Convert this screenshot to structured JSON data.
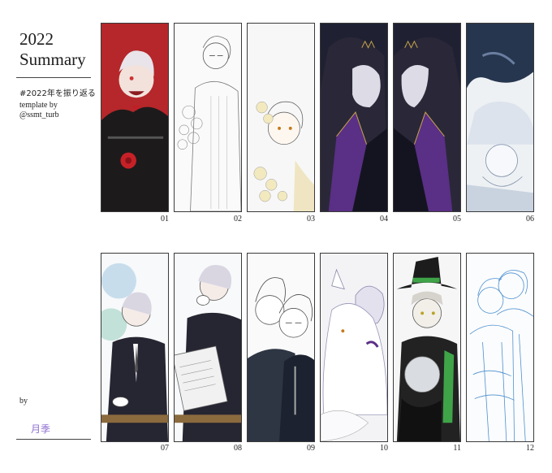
{
  "header": {
    "year": "2022",
    "title": "Summary",
    "hashtag": "#2022年を振り返る",
    "template_line1": "template by",
    "template_line2": "@ssmt_turb"
  },
  "footer": {
    "by": "by",
    "author": "月季"
  },
  "panels": [
    {
      "number": "01",
      "description": "red background, white-haired character laughing, black outfit with red rose"
    },
    {
      "number": "02",
      "description": "lineart of glasses character with floral bouquet"
    },
    {
      "number": "03",
      "description": "sketch character with roses in hair"
    },
    {
      "number": "04",
      "description": "hooded figure with crown, purple cloak, dark background"
    },
    {
      "number": "05",
      "description": "hooded figure with crown, purple cloak, mirrored"
    },
    {
      "number": "06",
      "description": "monochrome blue ink, character upside down"
    },
    {
      "number": "07",
      "description": "character in suit drinking from cup, sky background"
    },
    {
      "number": "08",
      "description": "character reading newspaper and drinking tea"
    },
    {
      "number": "09",
      "description": "two characters in sketch with glasses"
    },
    {
      "number": "10",
      "description": "white wolf with silver-haired character"
    },
    {
      "number": "11",
      "description": "character in green witch hat holding crystal ball"
    },
    {
      "number": "12",
      "description": "blue lineart sketch of two characters"
    }
  ],
  "colors": {
    "author": "#8f6fd1",
    "panel01_bg": "#b5272a",
    "panel04_bg": "#1f2133",
    "cloak_purple": "#5a2f86",
    "sketch_blue": "#4a8fd0"
  }
}
